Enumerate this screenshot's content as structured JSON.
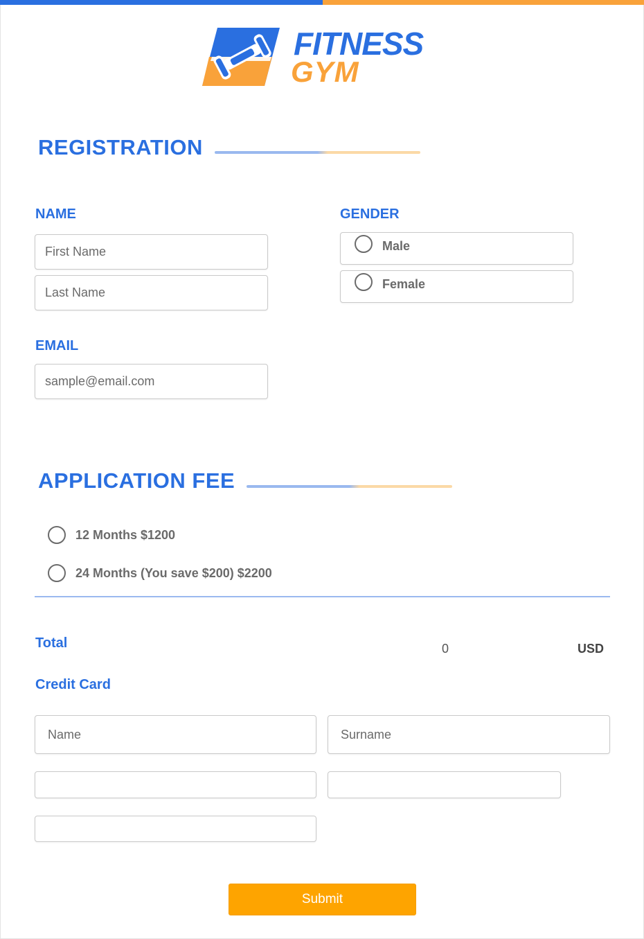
{
  "brand": {
    "line1": "FITNESS",
    "line2": "GYM",
    "primary_color": "#2a6fe0",
    "accent_color": "#f9a23a"
  },
  "registration": {
    "title": "REGISTRATION",
    "name_label": "NAME",
    "first_name_placeholder": "First Name",
    "last_name_placeholder": "Last Name",
    "email_label": "EMAIL",
    "email_placeholder": "sample@email.com",
    "gender_label": "GENDER",
    "gender_options": [
      "Male",
      "Female"
    ]
  },
  "application_fee": {
    "title": "APPLICATION FEE",
    "options": [
      "12 Months $1200",
      "24 Months (You save $200) $2200"
    ],
    "total_label": "Total",
    "total_value": "0",
    "total_currency": "USD",
    "credit_card_label": "Credit Card",
    "card_name_placeholder": "Name",
    "card_surname_placeholder": "Surname"
  },
  "submit_label": "Submit",
  "submit_color": "#fea400"
}
